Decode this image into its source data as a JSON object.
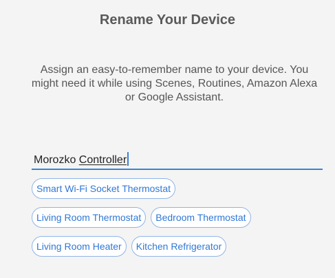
{
  "dialog": {
    "title": "Rename Your Device",
    "description": "Assign an easy-to-remember name to your device. You might need it while using Scenes, Routines, Amazon Alexa or Google Assistant."
  },
  "name_input": {
    "value_word1": "Morozko ",
    "value_word2": "Controller"
  },
  "suggestions": {
    "row1": [
      "Smart Wi-Fi Socket Thermostat"
    ],
    "row2": [
      "Living Room Thermostat",
      "Bedroom Thermostat"
    ],
    "row3": [
      "Living Room Heater",
      "Kitchen Refrigerator"
    ]
  },
  "colors": {
    "accent": "#3b7fd8",
    "chip_text": "#2f78d6",
    "background": "#f4f4f4"
  }
}
